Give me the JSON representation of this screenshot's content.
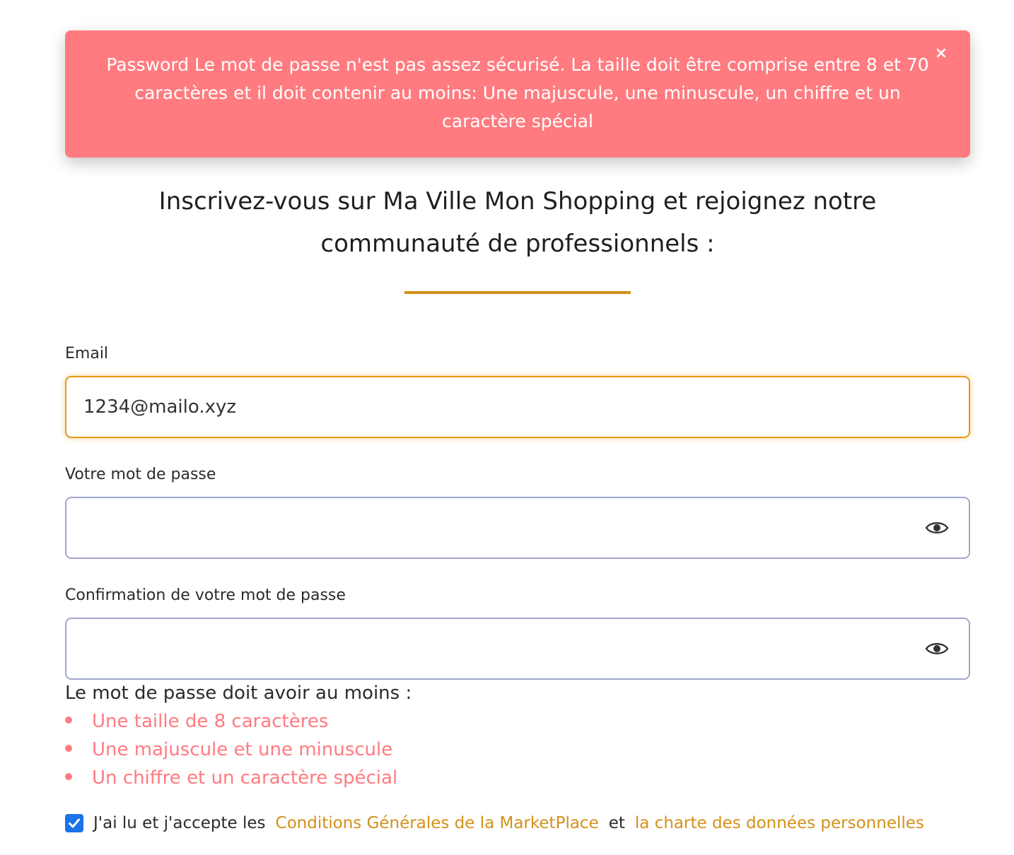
{
  "alert": {
    "message": "Password Le mot de passe n'est pas assez sécurisé. La taille doit être comprise entre 8 et 70 caractères et il doit contenir au moins: Une majuscule, une minuscule, un chiffre et un caractère spécial",
    "close_label": "×",
    "background": "#ff7b80"
  },
  "heading": {
    "line1": "Inscrivez-vous sur Ma Ville Mon Shopping et rejoignez notre",
    "line2": "communauté de professionnels :",
    "accent_color": "#d4901a"
  },
  "form": {
    "email": {
      "label": "Email",
      "value": "1234@mailo.xyz"
    },
    "password": {
      "label": "Votre mot de passe",
      "value": "",
      "toggle_icon": "eye-icon"
    },
    "password_confirm": {
      "label": "Confirmation de votre mot de passe",
      "value": "",
      "toggle_icon": "eye-icon"
    }
  },
  "password_rules": {
    "title": "Le mot de passe doit avoir au moins :",
    "items": [
      "Une taille de 8 caractères",
      "Une majuscule et une minuscule",
      "Un chiffre et un caractère spécial"
    ],
    "color": "#ff7b80"
  },
  "terms": {
    "checked": true,
    "prefix": "J'ai lu et j'accepte les",
    "link1": "Conditions Générales de la MarketPlace",
    "joiner": "et",
    "link2": "la charte des données personnelles",
    "link_color": "#d4901a"
  }
}
